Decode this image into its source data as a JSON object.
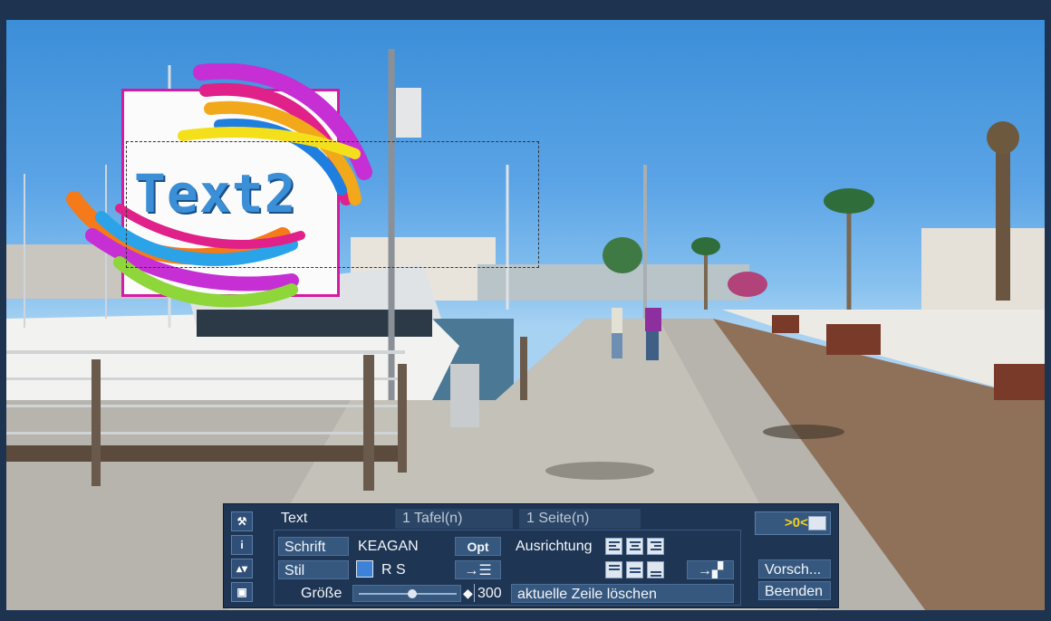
{
  "title_overlay": {
    "text": "Text2"
  },
  "panel": {
    "side_buttons": [
      {
        "icon": "wrench-icon",
        "glyph": "⚒"
      },
      {
        "icon": "info-icon",
        "glyph": "i"
      },
      {
        "icon": "up-down-triangle-icon",
        "glyph": "▴▾"
      },
      {
        "icon": "square-icon",
        "glyph": "▣"
      }
    ],
    "tabs": [
      {
        "label": "Text",
        "active": true
      },
      {
        "label": "1 Tafel(n)",
        "active": false
      },
      {
        "label": "1 Seite(n)",
        "active": false
      }
    ],
    "font_button": "Schrift",
    "font_value": "KEAGAN",
    "opt_button": "Opt",
    "style_button": "Stil",
    "style_value": "R S",
    "style_color": "#3c82d8",
    "size_label": "Größe",
    "size_value": "300",
    "size_level_percent": 55,
    "alignment_label": "Ausrichtung",
    "delete_line_button": "aktuelle Zeile löschen",
    "keyboard_zero": ">0<",
    "preview_button": "Vorsch...",
    "exit_button": "Beenden"
  }
}
